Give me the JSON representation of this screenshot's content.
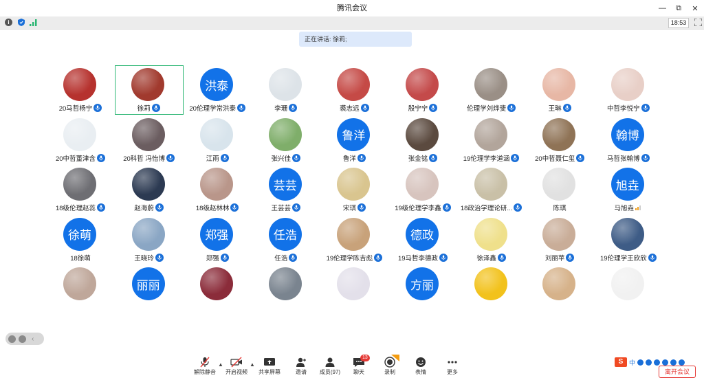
{
  "window": {
    "title": "腾讯会议",
    "controls": [
      "—",
      "⧉",
      "✕"
    ]
  },
  "statusbar": {
    "time": "18:53"
  },
  "banner": {
    "speaking_text": "正在讲话: 徐莉;"
  },
  "colors": {
    "accent": "#1272e8",
    "active_border": "#2bb673",
    "danger": "#e53935"
  },
  "participants": [
    {
      "name": "20马哲杨宁",
      "avatar": "photo",
      "color": "#b6322e",
      "mic": true
    },
    {
      "name": "徐莉",
      "avatar": "photo",
      "color": "#a13a2e",
      "mic": true,
      "active": true
    },
    {
      "name": "20伦理学常洪泰",
      "avatar": "text",
      "avatar_text": "洪泰",
      "mic": true
    },
    {
      "name": "李珊",
      "avatar": "photo",
      "color": "#dde3e8",
      "mic": true
    },
    {
      "name": "裘志远",
      "avatar": "photo",
      "color": "#c54a46",
      "mic": true
    },
    {
      "name": "殷宁宁",
      "avatar": "photo",
      "color": "#c44a4a",
      "mic": true
    },
    {
      "name": "伦理学刘烨斐",
      "avatar": "photo",
      "color": "#9a8f86",
      "mic": true
    },
    {
      "name": "王琳",
      "avatar": "photo",
      "color": "#e7b7a5",
      "mic": true
    },
    {
      "name": "中哲李悦宁",
      "avatar": "photo",
      "color": "#e8cfc7",
      "mic": true
    },
    {
      "name": "20中哲董津含",
      "avatar": "photo",
      "color": "#e9eef2",
      "mic": true
    },
    {
      "name": "20科哲 冯怡博",
      "avatar": "photo",
      "color": "#6b5d60",
      "mic": true
    },
    {
      "name": "江雨",
      "avatar": "photo",
      "color": "#d8e4ec",
      "mic": true
    },
    {
      "name": "张兴佳",
      "avatar": "photo",
      "color": "#7fae6a",
      "mic": true
    },
    {
      "name": "鲁洋",
      "avatar": "text",
      "avatar_text": "鲁洋",
      "mic": true
    },
    {
      "name": "张金铭",
      "avatar": "photo",
      "color": "#5b4a3f",
      "mic": true
    },
    {
      "name": "19伦理学李道涵",
      "avatar": "photo",
      "color": "#b2a59b",
      "mic": true
    },
    {
      "name": "20中哲聂仁玺",
      "avatar": "photo",
      "color": "#8f7356",
      "mic": true
    },
    {
      "name": "马哲张翰博",
      "avatar": "text",
      "avatar_text": "翰博",
      "mic": true
    },
    {
      "name": "18级伦理赵蕊",
      "avatar": "photo",
      "color": "#6e6e73",
      "mic": true
    },
    {
      "name": "赵海蔚",
      "avatar": "photo",
      "color": "#2c3a52",
      "mic": true
    },
    {
      "name": "18级赵林林",
      "avatar": "photo",
      "color": "#b9968a",
      "mic": true
    },
    {
      "name": "王芸芸",
      "avatar": "text",
      "avatar_text": "芸芸",
      "mic": true
    },
    {
      "name": "宋琪",
      "avatar": "photo",
      "color": "#d9c58f",
      "mic": true
    },
    {
      "name": "19级伦理学李鑫",
      "avatar": "photo",
      "color": "#d7c4be",
      "mic": true
    },
    {
      "name": "18政治学理论研...",
      "avatar": "photo",
      "color": "#c9c0a7",
      "mic": true
    },
    {
      "name": "陈琪",
      "avatar": "photo",
      "color": "#e1e1e1",
      "mic": false
    },
    {
      "name": "马旭垚",
      "avatar": "text",
      "avatar_text": "旭垚",
      "mic": false,
      "signal": true
    },
    {
      "name": "18徐萌",
      "avatar": "text",
      "avatar_text": "徐萌",
      "mic": false
    },
    {
      "name": "王晓玲",
      "avatar": "photo",
      "color": "#8aa6c4",
      "mic": true
    },
    {
      "name": "郑强",
      "avatar": "text",
      "avatar_text": "郑强",
      "mic": true
    },
    {
      "name": "任浩",
      "avatar": "text",
      "avatar_text": "任浩",
      "mic": true
    },
    {
      "name": "19伦理学陈吉彪",
      "avatar": "photo",
      "color": "#c8a27a",
      "mic": true
    },
    {
      "name": "19马哲李德政",
      "avatar": "text",
      "avatar_text": "德政",
      "mic": true
    },
    {
      "name": "徐泽鑫",
      "avatar": "photo",
      "color": "#efe08b",
      "mic": true
    },
    {
      "name": "刘丽苹",
      "avatar": "photo",
      "color": "#c9ad98",
      "mic": true
    },
    {
      "name": "19伦理学王欣欣",
      "avatar": "photo",
      "color": "#3e5c86",
      "mic": true
    },
    {
      "name": "",
      "avatar": "photo",
      "color": "#bfa79a",
      "mic": false
    },
    {
      "name": "",
      "avatar": "text",
      "avatar_text": "丽丽",
      "mic": false
    },
    {
      "name": "",
      "avatar": "photo",
      "color": "#8b2c3a",
      "mic": false
    },
    {
      "name": "",
      "avatar": "photo",
      "color": "#7a848f",
      "mic": false
    },
    {
      "name": "",
      "avatar": "photo",
      "color": "#e3e0ea",
      "mic": false
    },
    {
      "name": "",
      "avatar": "text",
      "avatar_text": "方丽",
      "mic": false
    },
    {
      "name": "",
      "avatar": "photo",
      "color": "#f2c21c",
      "mic": false
    },
    {
      "name": "",
      "avatar": "photo",
      "color": "#d6b28a",
      "mic": false
    },
    {
      "name": "",
      "avatar": "photo",
      "color": "#f1f1f1",
      "mic": false
    }
  ],
  "toolbar": {
    "mute": "解除静音",
    "video": "开启视频",
    "share": "共享屏幕",
    "invite": "邀请",
    "members": "成员(97)",
    "chat": "聊天",
    "chat_badge": "13",
    "record": "录制",
    "emoji": "表情",
    "more": "更多"
  },
  "ime": {
    "logo": "S",
    "mode": "中"
  },
  "leave": {
    "label": "离开会议"
  }
}
